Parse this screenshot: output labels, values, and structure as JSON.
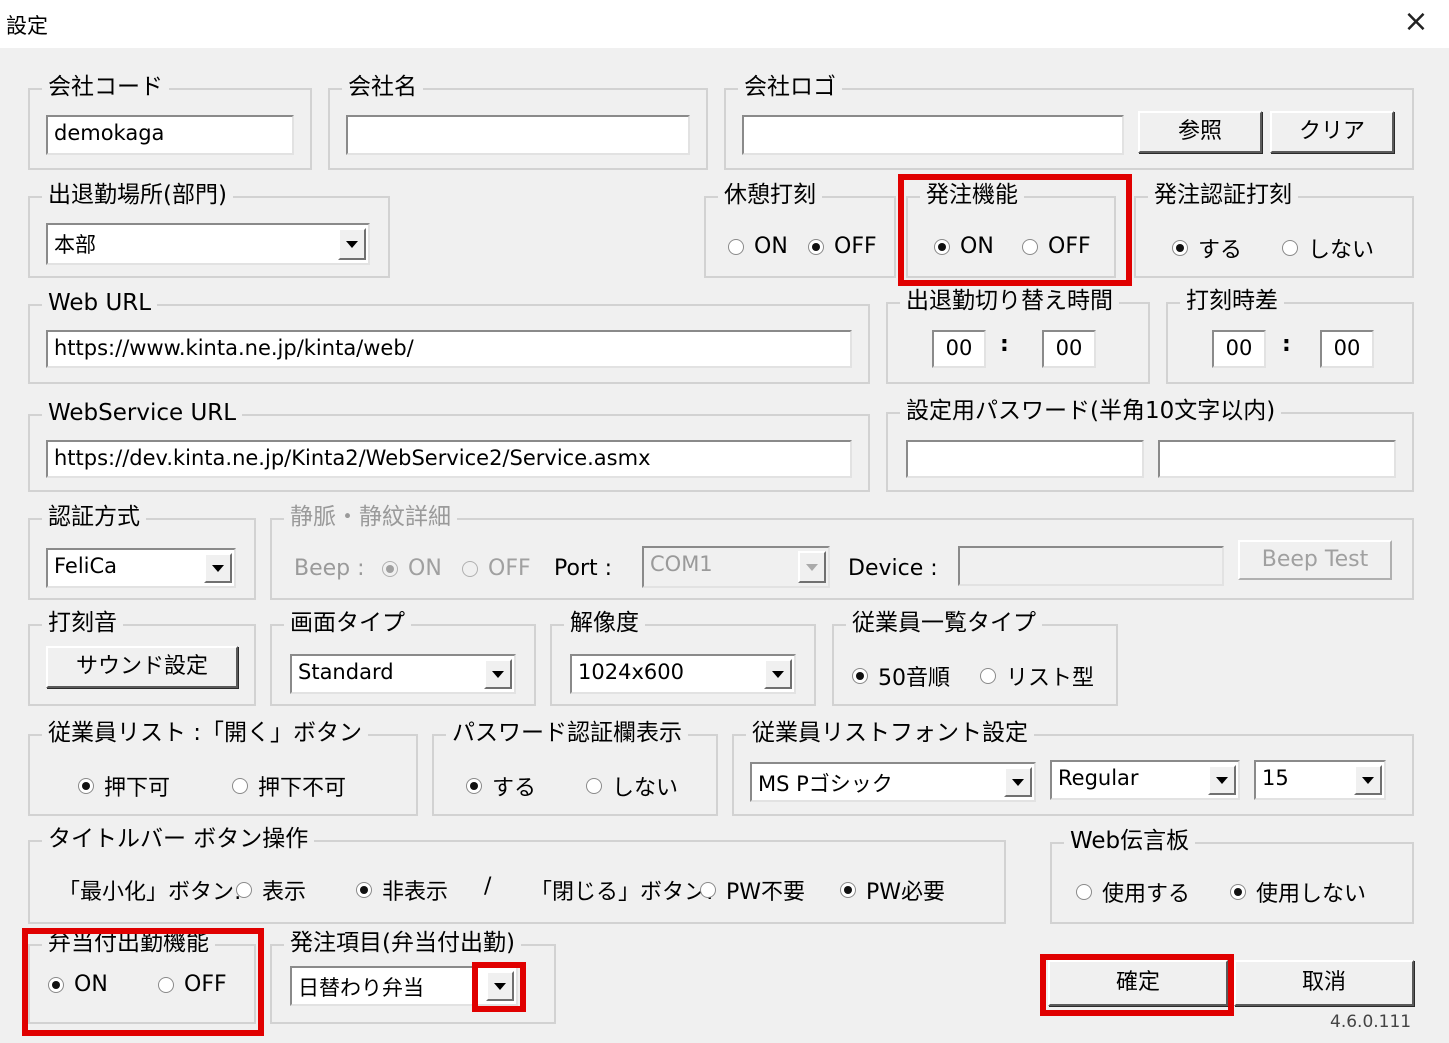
{
  "window": {
    "title": "設定",
    "close_icon": "×"
  },
  "company_code": {
    "label": "会社コード",
    "value": "demokaga"
  },
  "company_name": {
    "label": "会社名",
    "value": ""
  },
  "company_logo": {
    "label": "会社ロゴ",
    "value": "",
    "browse": "参照",
    "clear": "クリア"
  },
  "location": {
    "label": "出退勤場所(部門)",
    "value": "本部"
  },
  "break_stamp": {
    "label": "休憩打刻",
    "on": "ON",
    "off": "OFF",
    "selected": "off"
  },
  "order_function": {
    "label": "発注機能",
    "on": "ON",
    "off": "OFF",
    "selected": "on"
  },
  "order_auth_stamp": {
    "label": "発注認証打刻",
    "yes": "する",
    "no": "しない",
    "selected": "yes"
  },
  "web_url": {
    "label": "Web URL",
    "value": "https://www.kinta.ne.jp/kinta/web/"
  },
  "switch_time": {
    "label": "出退勤切り替え時間",
    "hour": "00",
    "sep": ":",
    "minute": "00"
  },
  "stamp_diff": {
    "label": "打刻時差",
    "hour": "00",
    "sep": ":",
    "minute": "00"
  },
  "webservice_url": {
    "label": "WebService URL",
    "value": "https://dev.kinta.ne.jp/Kinta2/WebService2/Service.asmx"
  },
  "password": {
    "label": "設定用パスワード(半角10文字以内)",
    "value1": "",
    "value2": ""
  },
  "auth_method": {
    "label": "認証方式",
    "value": "FeliCa"
  },
  "vein_detail": {
    "label": "静脈・静紋詳細",
    "beep_label": "Beep :",
    "on": "ON",
    "off": "OFF",
    "selected": "on",
    "port_label": "Port :",
    "port_value": "COM1",
    "device_label": "Device :",
    "device_value": "",
    "beep_test": "Beep Test"
  },
  "stamp_sound": {
    "label": "打刻音",
    "button": "サウンド設定"
  },
  "screen_type": {
    "label": "画面タイプ",
    "value": "Standard"
  },
  "resolution": {
    "label": "解像度",
    "value": "1024x600"
  },
  "employee_list_type": {
    "label": "従業員一覧タイプ",
    "opt1": "50音順",
    "opt2": "リスト型",
    "selected": "opt1"
  },
  "open_button": {
    "label": "従業員リスト :「開く」ボタン",
    "opt1": "押下可",
    "opt2": "押下不可",
    "selected": "opt1"
  },
  "password_auth_display": {
    "label": "パスワード認証欄表示",
    "yes": "する",
    "no": "しない",
    "selected": "yes"
  },
  "font_settings": {
    "label": "従業員リストフォント設定",
    "font": "MS Pゴシック",
    "style": "Regular",
    "size": "15"
  },
  "titlebar_buttons": {
    "label": "タイトルバー ボタン操作",
    "minimize_label": "「最小化」ボタン:",
    "show": "表示",
    "hide": "非表示",
    "minimize_selected": "hide",
    "slash": "/",
    "close_label": "「閉じる」ボタン:",
    "pw_not_required": "PW不要",
    "pw_required": "PW必要",
    "close_selected": "pw_required"
  },
  "web_board": {
    "label": "Web伝言板",
    "use": "使用する",
    "not_use": "使用しない",
    "selected": "not_use"
  },
  "bento_attendance": {
    "label": "弁当付出勤機能",
    "on": "ON",
    "off": "OFF",
    "selected": "on"
  },
  "order_item": {
    "label": "発注項目(弁当付出勤)",
    "value": "日替わり弁当"
  },
  "actions": {
    "ok": "確定",
    "cancel": "取消"
  },
  "version": "4.6.0.111",
  "colors": {
    "highlight": "#e00000",
    "background": "#f0f0f0"
  }
}
